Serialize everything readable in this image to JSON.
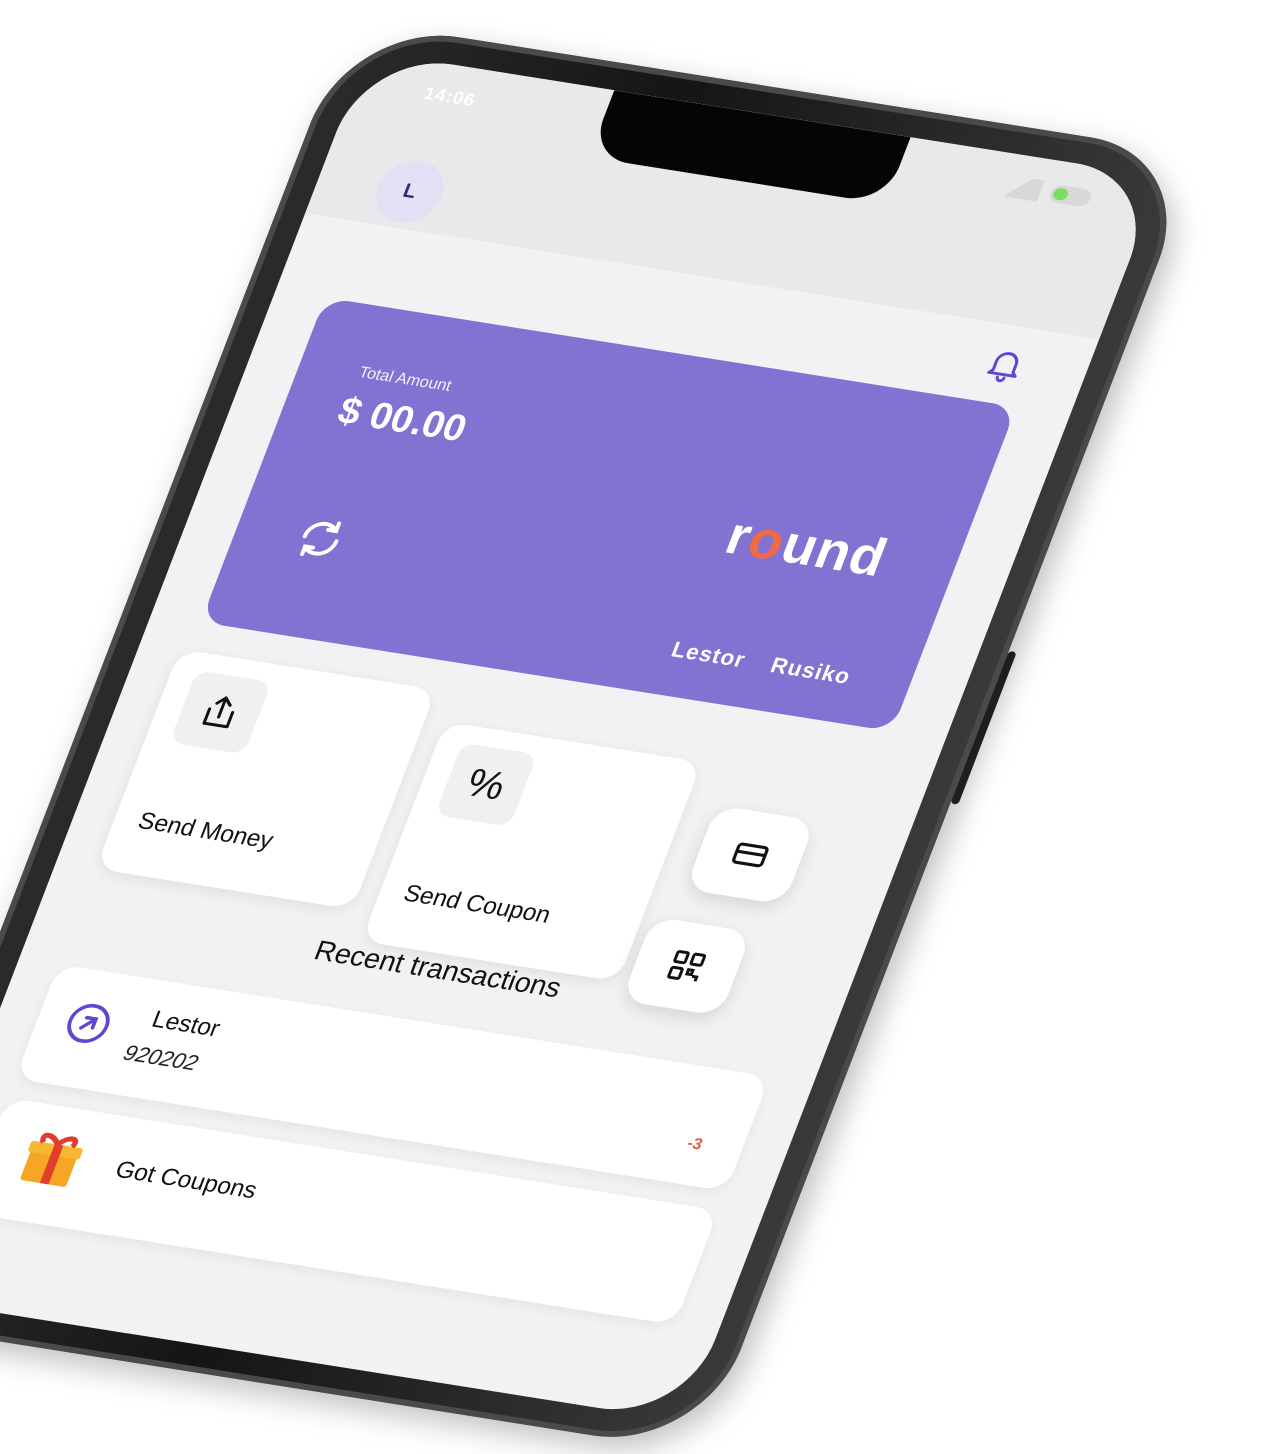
{
  "status": {
    "time": "14:06"
  },
  "header": {
    "avatar_initial": "L"
  },
  "card": {
    "label": "Total Amount",
    "amount": "$ 00.00",
    "brand": "round",
    "holder_first": "Lestor",
    "holder_last": "Rusiko"
  },
  "actions": [
    {
      "label": "Send Money",
      "icon": "share-icon"
    },
    {
      "label": "Send Coupon",
      "icon": "percent-icon"
    }
  ],
  "side_buttons": [
    {
      "icon": "credit-card-icon"
    },
    {
      "icon": "qr-code-icon"
    }
  ],
  "recent": {
    "title": "Recent transactions",
    "items": [
      {
        "name": "Lestor",
        "id": "920202",
        "icon": "arrow-up-right-icon",
        "badge": "-3"
      },
      {
        "name": "Got Coupons",
        "icon": "gift-icon"
      }
    ]
  },
  "colors": {
    "card": "#8472d3",
    "accent": "#5b49d6",
    "brand_o": "#f26a45"
  }
}
